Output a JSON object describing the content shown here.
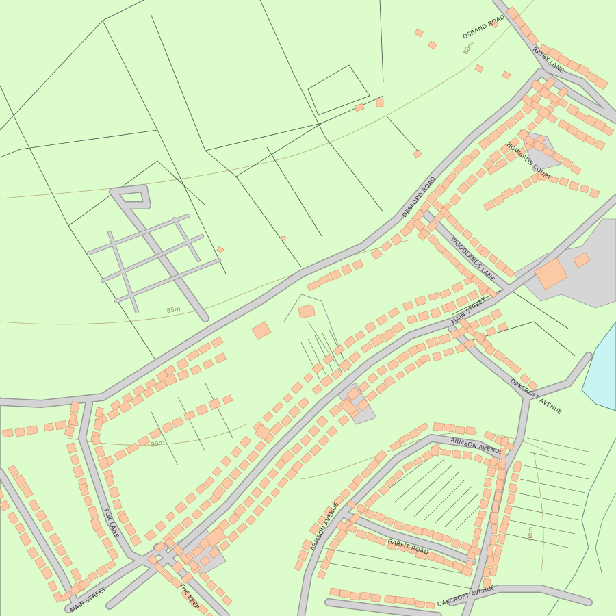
{
  "map": {
    "colors": {
      "land": "#dcfccc",
      "road_fill": "#d4d4d4",
      "road_edge": "#9a9a9a",
      "building": "#fbc9a5",
      "building_edge": "#d88c6a",
      "boundary": "#4a4a4a",
      "contour": "#b8a77a",
      "water": "#c8f4f2",
      "service_area": "#d6d6d6"
    },
    "roads": {
      "desford_road": "DESFORD ROAD",
      "main_street_ne": "MAIN STREET",
      "main_street_sw": "MAIN STREET",
      "ratby_lane": "RATBY LANE",
      "osbaston_road": "OSBAND ROAD",
      "howards_court": "HOWARDS COURT",
      "woodlands_lane": "WOODLANDS LANE",
      "oakcroft_avenue_n": "OAKCROFT AVENUE",
      "armson_avenue_n": "ARMSON AVENUE",
      "armson_avenue_w": "ARMSON AVENUE",
      "garfit_road": "GARFIT ROAD",
      "oakcroft_avenue_s": "OAKCROFT AVENUE",
      "fox_lane": "FOX LANE",
      "the_keep": "THE KEEP"
    },
    "contours": {
      "c85": "85m",
      "c80a": "80m",
      "c80b": "80m",
      "c80c": "80m"
    }
  }
}
